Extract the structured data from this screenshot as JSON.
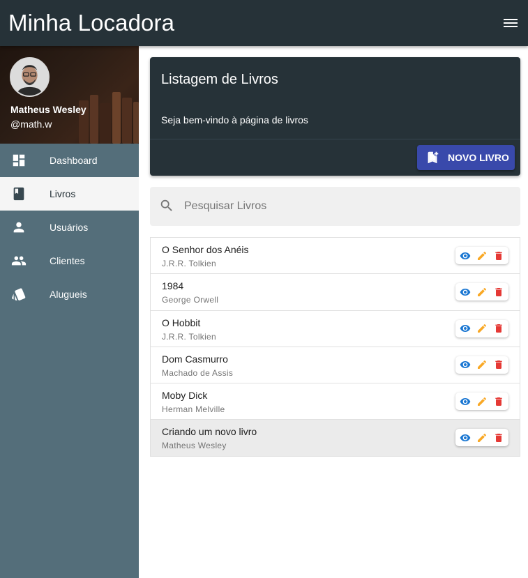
{
  "app": {
    "title": "Minha Locadora"
  },
  "profile": {
    "name": "Matheus Wesley",
    "handle": "@math.w"
  },
  "nav": [
    {
      "label": "Dashboard",
      "icon": "dashboard-icon"
    },
    {
      "label": "Livros",
      "icon": "book-icon",
      "active": true
    },
    {
      "label": "Usuários",
      "icon": "person-icon"
    },
    {
      "label": "Clientes",
      "icon": "group-icon"
    },
    {
      "label": "Alugueis",
      "icon": "cards-icon"
    }
  ],
  "header_card": {
    "title": "Listagem de Livros",
    "subtitle": "Seja bem-vindo à página de livros",
    "new_button": "NOVO LIVRO"
  },
  "search": {
    "placeholder": "Pesquisar Livros",
    "value": ""
  },
  "books": [
    {
      "title": "O Senhor dos Anéis",
      "author": "J.R.R. Tolkien"
    },
    {
      "title": "1984",
      "author": "George Orwell"
    },
    {
      "title": "O Hobbit",
      "author": "J.R.R. Tolkien"
    },
    {
      "title": "Dom Casmurro",
      "author": "Machado de Assis"
    },
    {
      "title": "Moby Dick",
      "author": "Herman Melville"
    },
    {
      "title": "Criando um novo livro",
      "author": "Matheus Wesley"
    }
  ],
  "colors": {
    "appbar": "#263238",
    "sidebar": "#546e7a",
    "accent": "#3949ab",
    "view": "#1976d2",
    "edit": "#f9a825",
    "delete": "#e53935"
  }
}
